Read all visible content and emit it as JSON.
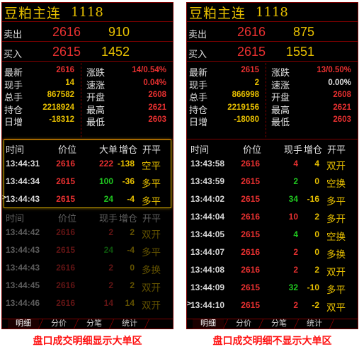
{
  "colors": {
    "red": "#e83030",
    "green": "#20c820",
    "yellow": "#e8c000",
    "white": "#e0e0e0",
    "border": "#7a0000"
  },
  "panels": [
    {
      "title": "豆粕主连",
      "code": "1118",
      "sell": {
        "label": "卖出",
        "price": "2616",
        "volume": "910"
      },
      "buy": {
        "label": "买入",
        "price": "2615",
        "volume": "1452"
      },
      "stats": [
        {
          "l1": "最新",
          "v1": "2616",
          "c1": "red",
          "l2": "涨跌",
          "v2": "14/0.54%",
          "c2": "red"
        },
        {
          "l1": "现手",
          "v1": "14",
          "c1": "yellow",
          "l2": "速涨",
          "v2": "0.04%",
          "c2": "red"
        },
        {
          "l1": "总手",
          "v1": "867582",
          "c1": "yellow",
          "l2": "开盘",
          "v2": "2608",
          "c2": "red"
        },
        {
          "l1": "持仓",
          "v1": "2218924",
          "c1": "yellow",
          "l2": "最高",
          "v2": "2621",
          "c2": "red"
        },
        {
          "l1": "日增",
          "v1": "-18312",
          "c1": "yellow",
          "l2": "最低",
          "v2": "2603",
          "c2": "red"
        }
      ],
      "headers": [
        "时间",
        "价位",
        "大单",
        "增仓",
        "开平"
      ],
      "headers_lower": [
        "时间",
        "价位",
        "现手",
        "增仓",
        "开平"
      ],
      "big_rows": [
        {
          "time": "13:44:31",
          "price": "2616",
          "pc": "red",
          "vol": "222",
          "vc": "red",
          "oi": "-138",
          "oc": "yellow",
          "type": "空平",
          "tc": "yellow"
        },
        {
          "time": "13:44:34",
          "price": "2615",
          "pc": "red",
          "vol": "100",
          "vc": "green",
          "oi": "-36",
          "oc": "yellow",
          "type": "多平",
          "tc": "yellow"
        },
        {
          "time": "13:44:43",
          "price": "2615",
          "pc": "red",
          "vol": "24",
          "vc": "green",
          "oi": "-4",
          "oc": "yellow",
          "type": "多平",
          "tc": "yellow"
        }
      ],
      "rows": [
        {
          "time": "13:44:42",
          "price": "2616",
          "pc": "red",
          "vol": "2",
          "vc": "red",
          "oi": "2",
          "oc": "yellow",
          "type": "双开",
          "tc": "yellow"
        },
        {
          "time": "13:44:43",
          "price": "2615",
          "pc": "red",
          "vol": "24",
          "vc": "green",
          "oi": "-4",
          "oc": "yellow",
          "type": "多平",
          "tc": "yellow"
        },
        {
          "time": "13:44:43",
          "price": "2616",
          "pc": "red",
          "vol": "2",
          "vc": "red",
          "oi": "0",
          "oc": "yellow",
          "type": "多换",
          "tc": "yellow"
        },
        {
          "time": "13:44:45",
          "price": "2616",
          "pc": "red",
          "vol": "2",
          "vc": "red",
          "oi": "2",
          "oc": "yellow",
          "type": "双开",
          "tc": "yellow"
        },
        {
          "time": "13:44:46",
          "price": "2616",
          "pc": "red",
          "vol": "14",
          "vc": "red",
          "oi": "14",
          "oc": "yellow",
          "type": "双开",
          "tc": "yellow"
        }
      ],
      "tabs": [
        "明细",
        "分价",
        "分笔",
        "统计"
      ],
      "caption": "盘口成交明细显示大单区"
    },
    {
      "title": "豆粕主连",
      "code": "1118",
      "sell": {
        "label": "卖出",
        "price": "2616",
        "volume": "875"
      },
      "buy": {
        "label": "买入",
        "price": "2615",
        "volume": "1551"
      },
      "stats": [
        {
          "l1": "最新",
          "v1": "2615",
          "c1": "red",
          "l2": "涨跌",
          "v2": "13/0.50%",
          "c2": "red"
        },
        {
          "l1": "现手",
          "v1": "2",
          "c1": "yellow",
          "l2": "速涨",
          "v2": "0.00%",
          "c2": "white"
        },
        {
          "l1": "总手",
          "v1": "866998",
          "c1": "yellow",
          "l2": "开盘",
          "v2": "2608",
          "c2": "red"
        },
        {
          "l1": "持仓",
          "v1": "2219156",
          "c1": "yellow",
          "l2": "最高",
          "v2": "2621",
          "c2": "red"
        },
        {
          "l1": "日增",
          "v1": "-18080",
          "c1": "yellow",
          "l2": "最低",
          "v2": "2603",
          "c2": "red"
        }
      ],
      "headers": [
        "时间",
        "价位",
        "现手",
        "增仓",
        "开平"
      ],
      "rows": [
        {
          "time": "13:43:58",
          "price": "2616",
          "pc": "red",
          "vol": "4",
          "vc": "red",
          "oi": "4",
          "oc": "yellow",
          "type": "双开",
          "tc": "yellow"
        },
        {
          "time": "13:43:59",
          "price": "2615",
          "pc": "red",
          "vol": "2",
          "vc": "green",
          "oi": "0",
          "oc": "yellow",
          "type": "空换",
          "tc": "yellow"
        },
        {
          "time": "13:44:02",
          "price": "2615",
          "pc": "red",
          "vol": "34",
          "vc": "green",
          "oi": "-16",
          "oc": "yellow",
          "type": "多平",
          "tc": "yellow"
        },
        {
          "time": "13:44:04",
          "price": "2616",
          "pc": "red",
          "vol": "10",
          "vc": "red",
          "oi": "2",
          "oc": "yellow",
          "type": "多开",
          "tc": "yellow"
        },
        {
          "time": "13:44:05",
          "price": "2615",
          "pc": "red",
          "vol": "4",
          "vc": "green",
          "oi": "0",
          "oc": "yellow",
          "type": "空换",
          "tc": "yellow"
        },
        {
          "time": "13:44:07",
          "price": "2616",
          "pc": "red",
          "vol": "2",
          "vc": "red",
          "oi": "0",
          "oc": "yellow",
          "type": "多换",
          "tc": "yellow"
        },
        {
          "time": "13:44:08",
          "price": "2616",
          "pc": "red",
          "vol": "2",
          "vc": "red",
          "oi": "2",
          "oc": "yellow",
          "type": "双开",
          "tc": "yellow"
        },
        {
          "time": "13:44:09",
          "price": "2615",
          "pc": "red",
          "vol": "32",
          "vc": "green",
          "oi": "-10",
          "oc": "yellow",
          "type": "多平",
          "tc": "yellow"
        },
        {
          "time": "13:44:10",
          "price": "2615",
          "pc": "red",
          "vol": "2",
          "vc": "red",
          "oi": "-2",
          "oc": "yellow",
          "type": "双平",
          "tc": "yellow"
        }
      ],
      "tabs": [
        "明细",
        "分价",
        "分笔",
        "统计"
      ],
      "caption": "盘口成交明细不显示大单区"
    }
  ]
}
